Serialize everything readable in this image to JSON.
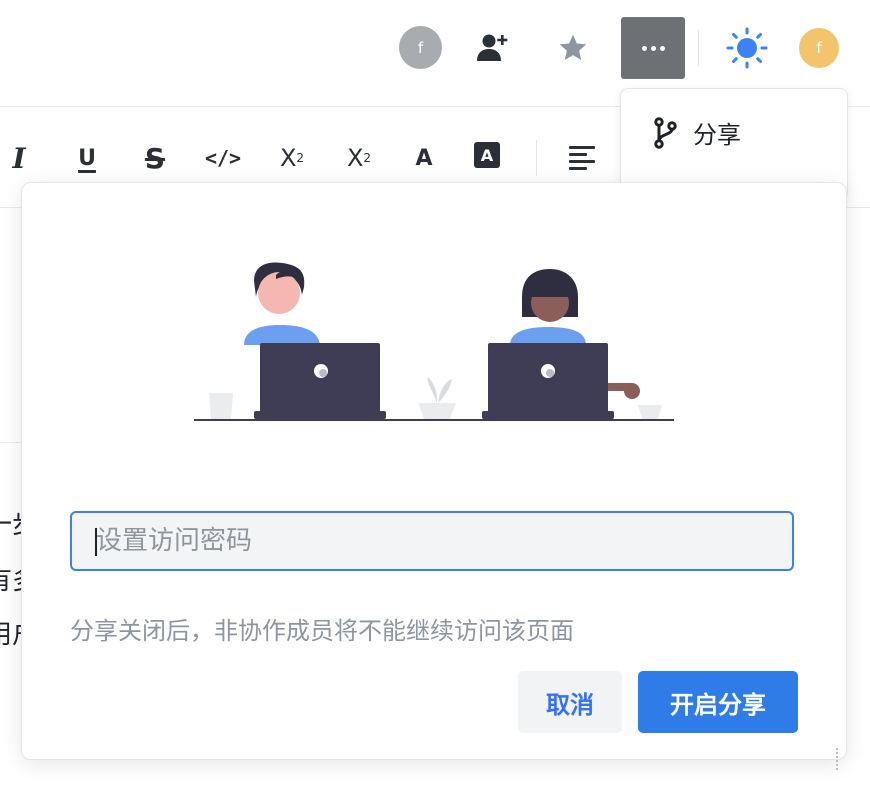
{
  "header": {
    "collaborator_avatar": "f",
    "user_avatar": "f",
    "icons": [
      "add-collaborator-icon",
      "star-icon",
      "more-icon",
      "theme-sun-icon"
    ],
    "colors": {
      "more_button_bg": "#6d7075",
      "sun": "#3b82f6",
      "user_avatar_bg": "#f2c46b",
      "collaborator_avatar_bg": "#a8abb0"
    }
  },
  "toolbar": {
    "superscript": {
      "base": "X",
      "mark": "2"
    },
    "subscript": {
      "base": "X",
      "mark": "2"
    },
    "font_color_label": "A",
    "bg_color_label": "A",
    "icons": [
      "italic-icon",
      "underline-icon",
      "strikethrough-icon",
      "code-icon",
      "superscript-icon",
      "subscript-icon",
      "font-color-icon",
      "highlight-icon",
      "align-left-icon"
    ]
  },
  "editor_fragments": [
    "一步",
    "有多",
    "用户"
  ],
  "dropdown": {
    "share_label": "分享",
    "share_icon": "branch-icon"
  },
  "dialog": {
    "password_placeholder": "设置访问密码",
    "password_value": "",
    "hint": "分享关闭后，非协作成员将不能继续访问该页面",
    "cancel_label": "取消",
    "confirm_label": "开启分享",
    "colors": {
      "primary": "#2f7ce8",
      "input_border": "#3b82e6"
    }
  }
}
